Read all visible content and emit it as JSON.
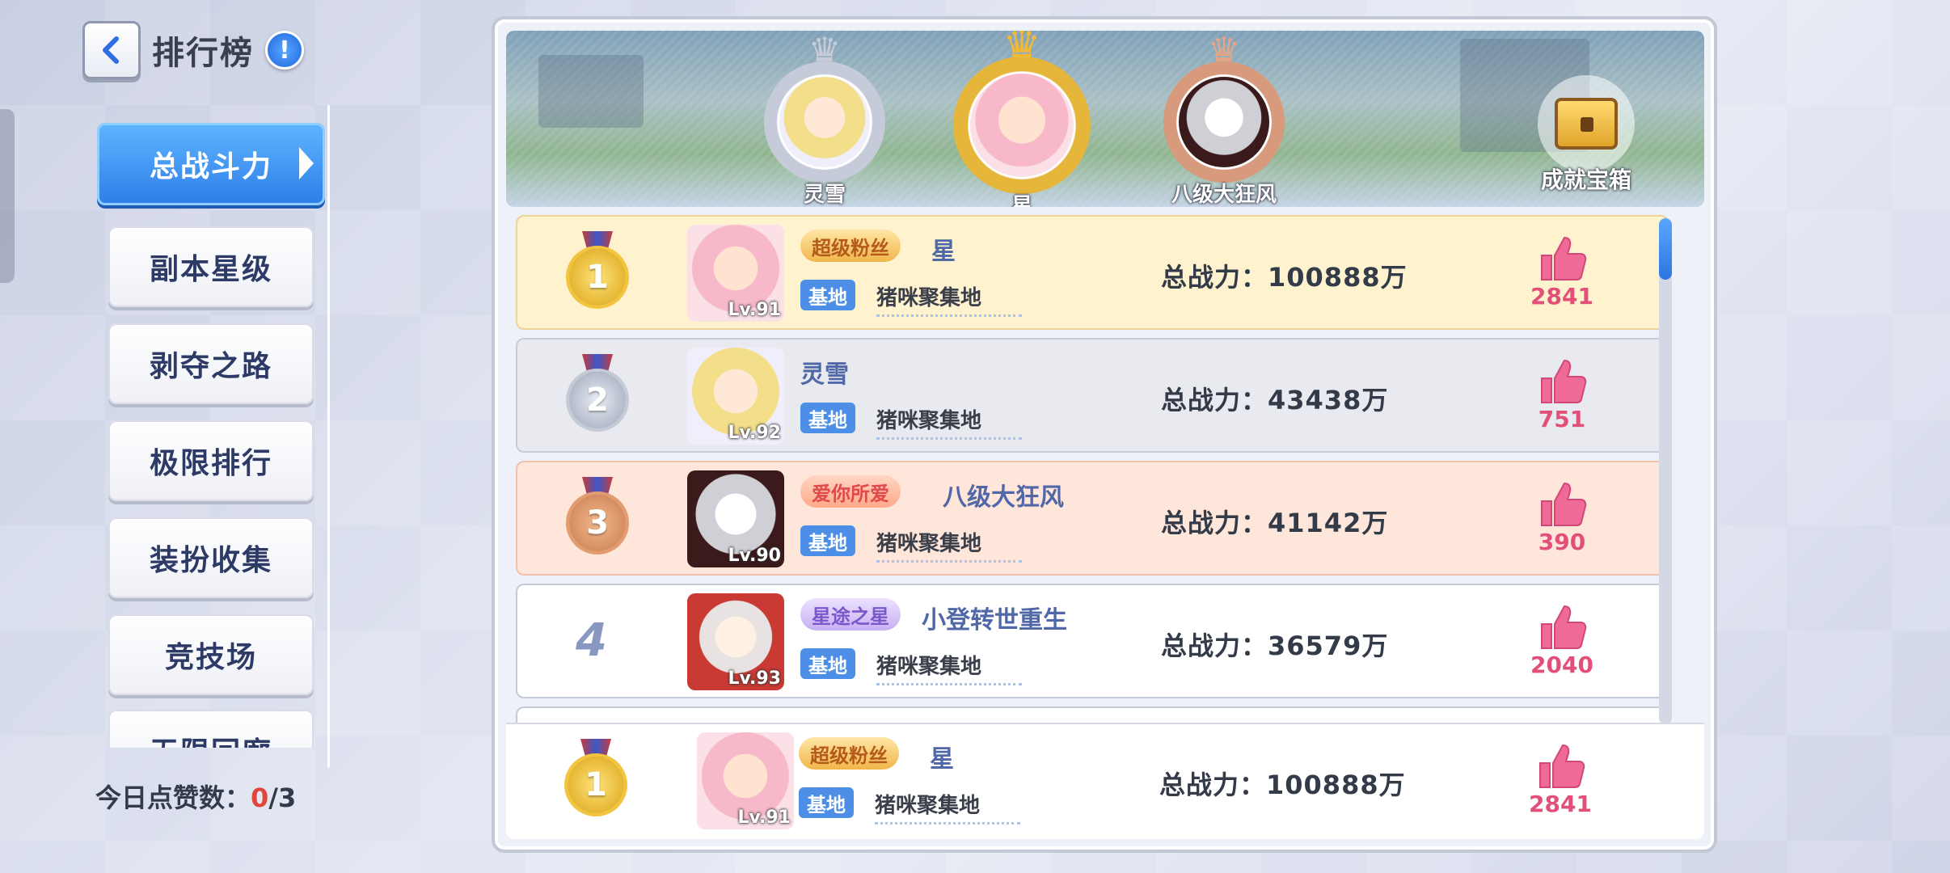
{
  "header": {
    "title": "排行榜",
    "info_icon": "!"
  },
  "sidebar": {
    "items": [
      {
        "label": "总战斗力",
        "active": true
      },
      {
        "label": "副本星级"
      },
      {
        "label": "剥夺之路"
      },
      {
        "label": "极限排行"
      },
      {
        "label": "装扮收集"
      },
      {
        "label": "竞技场"
      },
      {
        "label": "无限回廊"
      }
    ],
    "likes_today_label": "今日点赞数：",
    "likes_used": "0",
    "likes_total": "/3"
  },
  "banner": {
    "podium": [
      {
        "rank": 2,
        "name": "灵雪"
      },
      {
        "rank": 1,
        "name": "星"
      },
      {
        "rank": 3,
        "name": "八级大狂风"
      }
    ],
    "chest_label": "成就宝箱"
  },
  "rows": [
    {
      "rank": "1",
      "medal": "gold",
      "title_badge": "超级粉丝",
      "name": "星",
      "level": "Lv.91",
      "base_tag": "基地",
      "base_name": "猪咪聚集地",
      "power": "总战力：100888万",
      "likes": "2841"
    },
    {
      "rank": "2",
      "medal": "silver",
      "title_badge": "",
      "name": "灵雪",
      "level": "Lv.92",
      "base_tag": "基地",
      "base_name": "猪咪聚集地",
      "power": "总战力：43438万",
      "likes": "751"
    },
    {
      "rank": "3",
      "medal": "bronze",
      "title_badge": "爱你所爱",
      "name": "八级大狂风",
      "level": "Lv.90",
      "base_tag": "基地",
      "base_name": "猪咪聚集地",
      "power": "总战力：41142万",
      "likes": "390"
    },
    {
      "rank": "4",
      "medal": "",
      "title_badge": "星途之星",
      "name": "小登转世重生",
      "level": "Lv.93",
      "base_tag": "基地",
      "base_name": "猪咪聚集地",
      "power": "总战力：36579万",
      "likes": "2040"
    }
  ],
  "my_row": {
    "rank": "1",
    "medal": "gold",
    "title_badge": "超级粉丝",
    "name": "星",
    "level": "Lv.91",
    "base_tag": "基地",
    "base_name": "猪咪聚集地",
    "power": "总战力：100888万",
    "likes": "2841"
  },
  "colors": {
    "accent": "#2d7de8",
    "like": "#e2507a",
    "gold_row": "#fff3cf",
    "bronze_row": "#ffe6da"
  }
}
